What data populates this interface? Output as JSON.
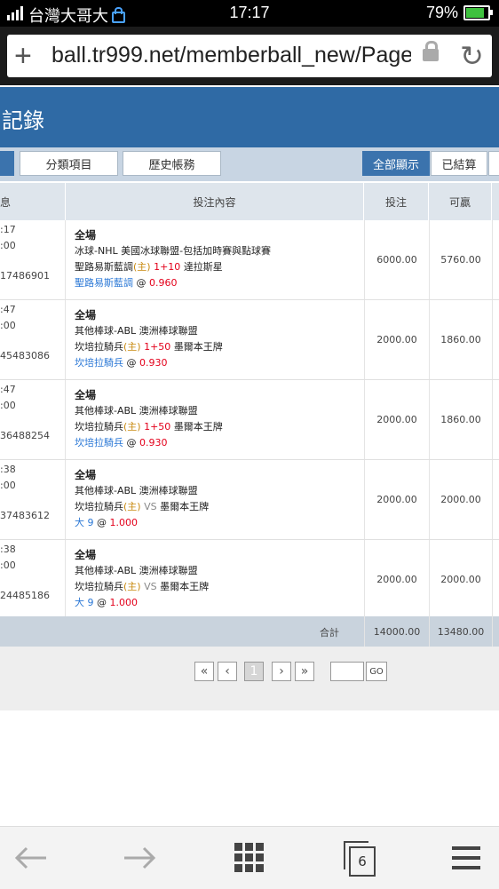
{
  "status_bar": {
    "carrier": "台灣大哥大",
    "time": "17:17",
    "battery": "79%",
    "battery_level": 0.79
  },
  "browser": {
    "url": "ball.tr999.net/memberball_new/Page",
    "tab_count": "6"
  },
  "page": {
    "title": "記錄",
    "toolbar": {
      "btn_category": "分類項目",
      "btn_history": "歷史帳務",
      "btn_show_all": "全部顯示",
      "btn_settled": "已結算"
    },
    "table": {
      "headers": {
        "info": "息",
        "content": "投注內容",
        "stake": "投注",
        "win": "可贏"
      },
      "rows": [
        {
          "info1": ":17",
          "info2": ":00",
          "info3": "17486901",
          "period": "全場",
          "league": "冰球-NHL 美國冰球聯盟-包括加時賽與點球賽",
          "team_home": "聖路易斯藍調",
          "home_tag": "(主)",
          "handicap": "1+10",
          "team_away": "達拉斯星",
          "pick": "聖路易斯藍調",
          "at": "@",
          "odds": "0.960",
          "stake": "6000.00",
          "win": "5760.00"
        },
        {
          "info1": ":47",
          "info2": ":00",
          "info3": "45483086",
          "period": "全場",
          "league": "其他棒球-ABL 澳洲棒球聯盟",
          "team_home": "坎培拉騎兵",
          "home_tag": "(主)",
          "handicap": "1+50",
          "team_away": "墨爾本王牌",
          "pick": "坎培拉騎兵",
          "at": "@",
          "odds": "0.930",
          "stake": "2000.00",
          "win": "1860.00"
        },
        {
          "info1": ":47",
          "info2": ":00",
          "info3": "36488254",
          "period": "全場",
          "league": "其他棒球-ABL 澳洲棒球聯盟",
          "team_home": "坎培拉騎兵",
          "home_tag": "(主)",
          "handicap": "1+50",
          "team_away": "墨爾本王牌",
          "pick": "坎培拉騎兵",
          "at": "@",
          "odds": "0.930",
          "stake": "2000.00",
          "win": "1860.00"
        },
        {
          "info1": ":38",
          "info2": ":00",
          "info3": "37483612",
          "period": "全場",
          "league": "其他棒球-ABL 澳洲棒球聯盟",
          "team_home": "坎培拉騎兵",
          "home_tag": "(主)",
          "handicap": "VS",
          "team_away": "墨爾本王牌",
          "pick": "大 9",
          "at": "@",
          "odds": "1.000",
          "stake": "2000.00",
          "win": "2000.00"
        },
        {
          "info1": ":38",
          "info2": ":00",
          "info3": "24485186",
          "period": "全場",
          "league": "其他棒球-ABL 澳洲棒球聯盟",
          "team_home": "坎培拉騎兵",
          "home_tag": "(主)",
          "handicap": "VS",
          "team_away": "墨爾本王牌",
          "pick": "大 9",
          "at": "@",
          "odds": "1.000",
          "stake": "2000.00",
          "win": "2000.00"
        }
      ],
      "total": {
        "label": "合計",
        "stake": "14000.00",
        "win": "13480.00"
      }
    },
    "pager": {
      "current_page": "1",
      "go_label": "GO"
    }
  }
}
